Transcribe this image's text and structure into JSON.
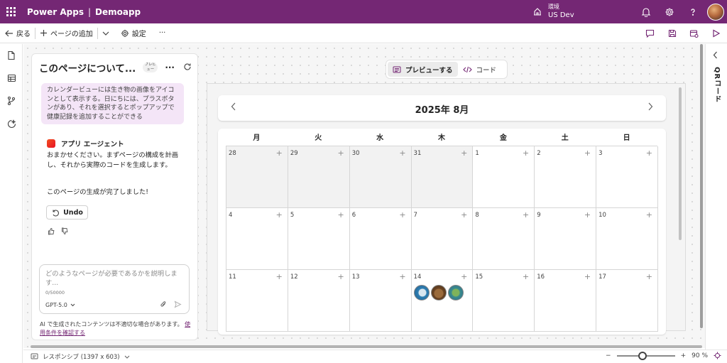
{
  "app": {
    "product": "Power Apps",
    "separator": "|",
    "app_name": "Demoapp",
    "environment_label": "環境",
    "environment_name": "US Dev",
    "brand_color": "#742774"
  },
  "commandbar": {
    "back": "戻る",
    "add_page": "ページの追加",
    "settings": "設定",
    "more": "···"
  },
  "rail": {
    "items": [
      "page-icon",
      "table-icon",
      "branch-icon",
      "copilot-icon"
    ]
  },
  "copilot_panel": {
    "title": "このページについて...",
    "preview_badge": "プレビュー",
    "more": "···",
    "user_message": "カレンダービューには生き物の画像をアイコンとして表示する。日にちには、プラスボタンがあり、それを選択するとポップアップで健康記録を追加することができる",
    "agent_name": "アプリ エージェント",
    "agent_message": "おまかせください。まずページの構成を計画し、それから実際のコードを生成します。",
    "agent_done": "このページの生成が完了しました!",
    "undo_label": "Undo",
    "prompt_placeholder": "どのようなページが必要であるかを説明します...",
    "char_count": "0/50000",
    "model": "GPT-5.0",
    "disclaimer_text": "AI で生成されたコンテンツは不適切な場合があります。",
    "disclaimer_link": "使用条件を確認する"
  },
  "view_toggle": {
    "preview": "プレビューする",
    "code": "コード",
    "active": "preview"
  },
  "calendar": {
    "month_title": "2025年 8月",
    "weekdays": [
      "月",
      "火",
      "水",
      "木",
      "金",
      "土",
      "日"
    ],
    "add_symbol": "+",
    "weeks": [
      [
        {
          "day": "28",
          "out": true
        },
        {
          "day": "29",
          "out": true
        },
        {
          "day": "30",
          "out": true
        },
        {
          "day": "31",
          "out": true
        },
        {
          "day": "1"
        },
        {
          "day": "2"
        },
        {
          "day": "3"
        }
      ],
      [
        {
          "day": "4"
        },
        {
          "day": "5"
        },
        {
          "day": "6"
        },
        {
          "day": "7"
        },
        {
          "day": "8"
        },
        {
          "day": "9"
        },
        {
          "day": "10"
        }
      ],
      [
        {
          "day": "11"
        },
        {
          "day": "12"
        },
        {
          "day": "13"
        },
        {
          "day": "14",
          "creatures": [
            "fish",
            "bear",
            "turtle"
          ]
        },
        {
          "day": "15"
        },
        {
          "day": "16"
        },
        {
          "day": "17"
        }
      ]
    ]
  },
  "statusbar": {
    "responsive": "レスポンシブ (1397 x 603)",
    "zoom_minus": "−",
    "zoom_plus": "+",
    "zoom_value": "90 %",
    "zoom_level": 0.9
  },
  "qr_panel": {
    "label": "QRコード"
  }
}
